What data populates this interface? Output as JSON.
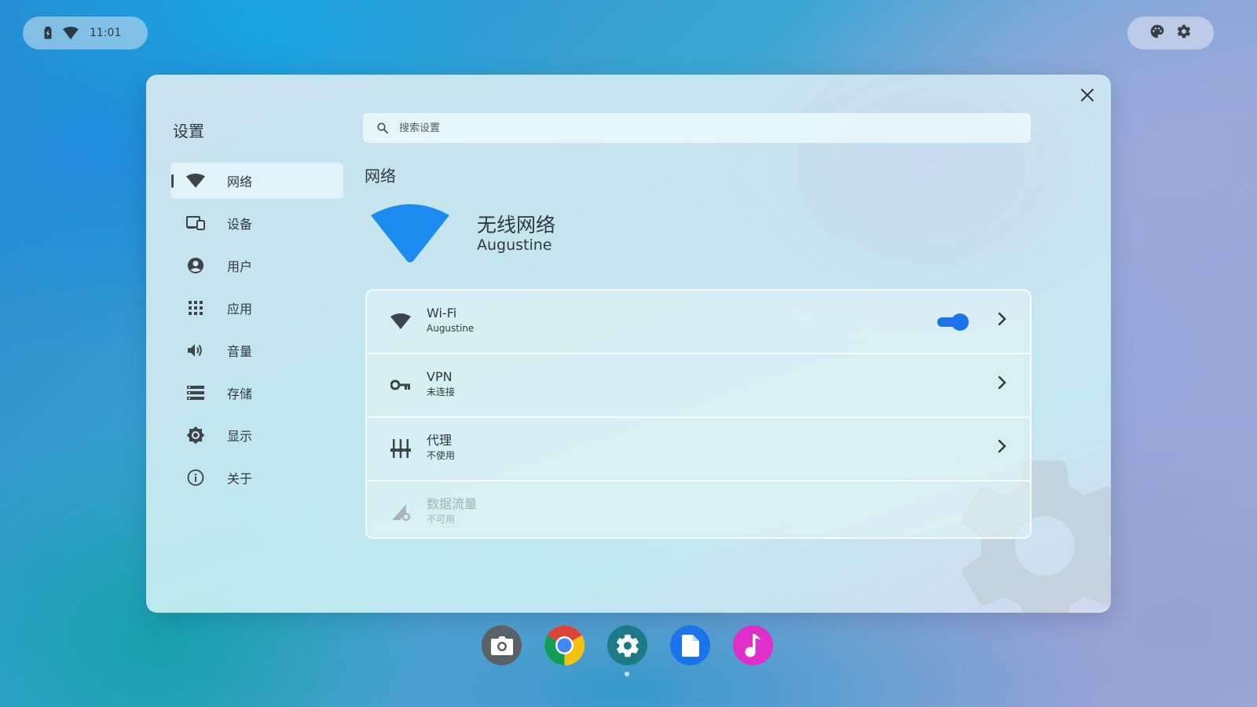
{
  "status_bar": {
    "time": "11:01",
    "icons": [
      "battery-icon",
      "wifi-icon"
    ]
  },
  "quick_settings": {
    "icons": [
      "palette-icon",
      "gear-icon"
    ]
  },
  "settings_window": {
    "app_title": "设置",
    "search": {
      "placeholder": "搜索设置",
      "value": ""
    },
    "nav": [
      {
        "label": "网络",
        "icon": "wifi-icon",
        "active": true
      },
      {
        "label": "设备",
        "icon": "devices-icon",
        "active": false
      },
      {
        "label": "用户",
        "icon": "account-icon",
        "active": false
      },
      {
        "label": "应用",
        "icon": "apps-grid-icon",
        "active": false
      },
      {
        "label": "音量",
        "icon": "volume-icon",
        "active": false
      },
      {
        "label": "存储",
        "icon": "storage-icon",
        "active": false
      },
      {
        "label": "显示",
        "icon": "brightness-icon",
        "active": false
      },
      {
        "label": "关于",
        "icon": "info-icon",
        "active": false
      }
    ],
    "section_title": "网络",
    "hero": {
      "title": "无线网络",
      "subtitle": "Augustine",
      "icon": "wifi-icon"
    },
    "rows": [
      {
        "title": "Wi-Fi",
        "subtitle": "Augustine",
        "icon": "wifi-icon",
        "toggle_on": true,
        "enabled": true
      },
      {
        "title": "VPN",
        "subtitle": "未连接",
        "icon": "vpn-key-icon",
        "enabled": true
      },
      {
        "title": "代理",
        "subtitle": "不使用",
        "icon": "proxy-tune-icon",
        "enabled": true
      },
      {
        "title": "数据流量",
        "subtitle": "不可用",
        "icon": "cellular-data-icon",
        "enabled": false
      }
    ],
    "colors": {
      "accent": "#1a73e8",
      "hero_icon": "#1a8cf0"
    }
  },
  "dock": {
    "apps": [
      {
        "name": "camera-app",
        "icon": "camera-icon",
        "color": "#5a6166"
      },
      {
        "name": "chrome-app",
        "icon": "chrome-icon",
        "color": "#ffffff"
      },
      {
        "name": "settings-app",
        "icon": "gear-icon",
        "color": "#1b7a86"
      },
      {
        "name": "files-app",
        "icon": "file-icon",
        "color": "#1a73e8"
      },
      {
        "name": "music-app",
        "icon": "music-note-icon",
        "color": "#e02ec8"
      }
    ]
  }
}
